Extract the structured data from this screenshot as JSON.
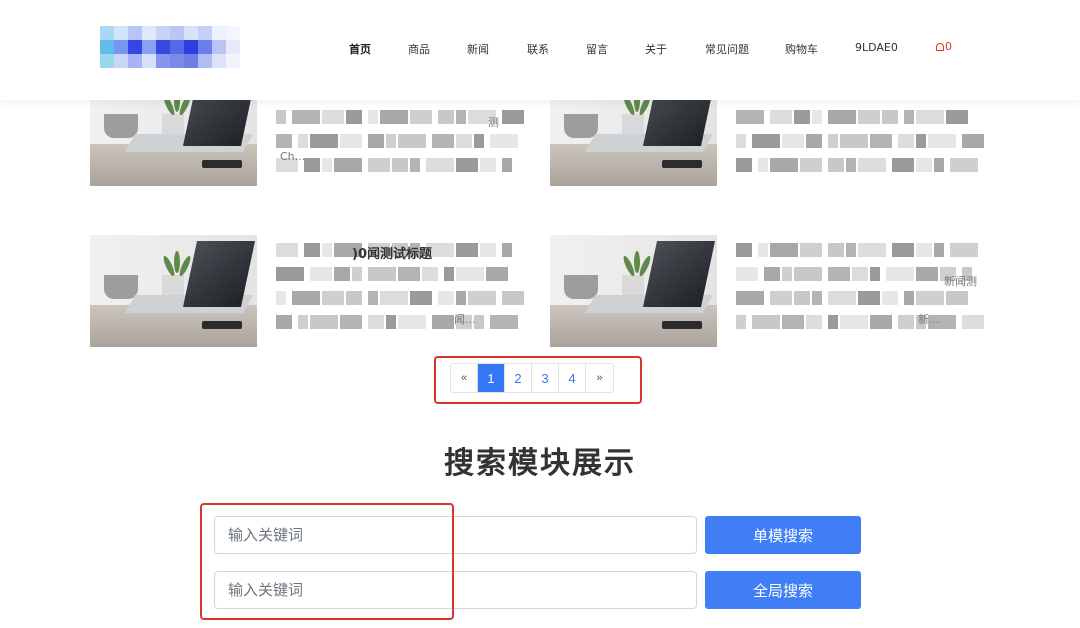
{
  "header": {
    "nav": [
      {
        "label": "首页",
        "active": true
      },
      {
        "label": "商品"
      },
      {
        "label": "新闻"
      },
      {
        "label": "联系"
      },
      {
        "label": "留言"
      },
      {
        "label": "关于"
      },
      {
        "label": "常见问题"
      },
      {
        "label": "购物车"
      },
      {
        "label": "9LDAE0"
      }
    ],
    "cart_count": "0"
  },
  "news": {
    "items": [
      {
        "fragment": "测",
        "fragment2": "Ch..."
      },
      {
        "fragment": "",
        "fragment2": ""
      },
      {
        "fragment": ")0闻测试标题",
        "fragment2": "闻..."
      },
      {
        "fragment": "新闻测",
        "fragment2": "新..."
      }
    ]
  },
  "pagination": {
    "prev": "«",
    "pages": [
      "1",
      "2",
      "3",
      "4"
    ],
    "current": "1",
    "next": "»"
  },
  "search_module": {
    "title": "搜索模块展示",
    "single": {
      "placeholder": "输入关键词",
      "button": "单模搜索"
    },
    "global": {
      "placeholder": "输入关键词",
      "button": "全局搜索"
    }
  },
  "colors": {
    "accent": "#3f7ef5",
    "annotation_red": "#d6362c",
    "cart_red": "#e0342f"
  }
}
